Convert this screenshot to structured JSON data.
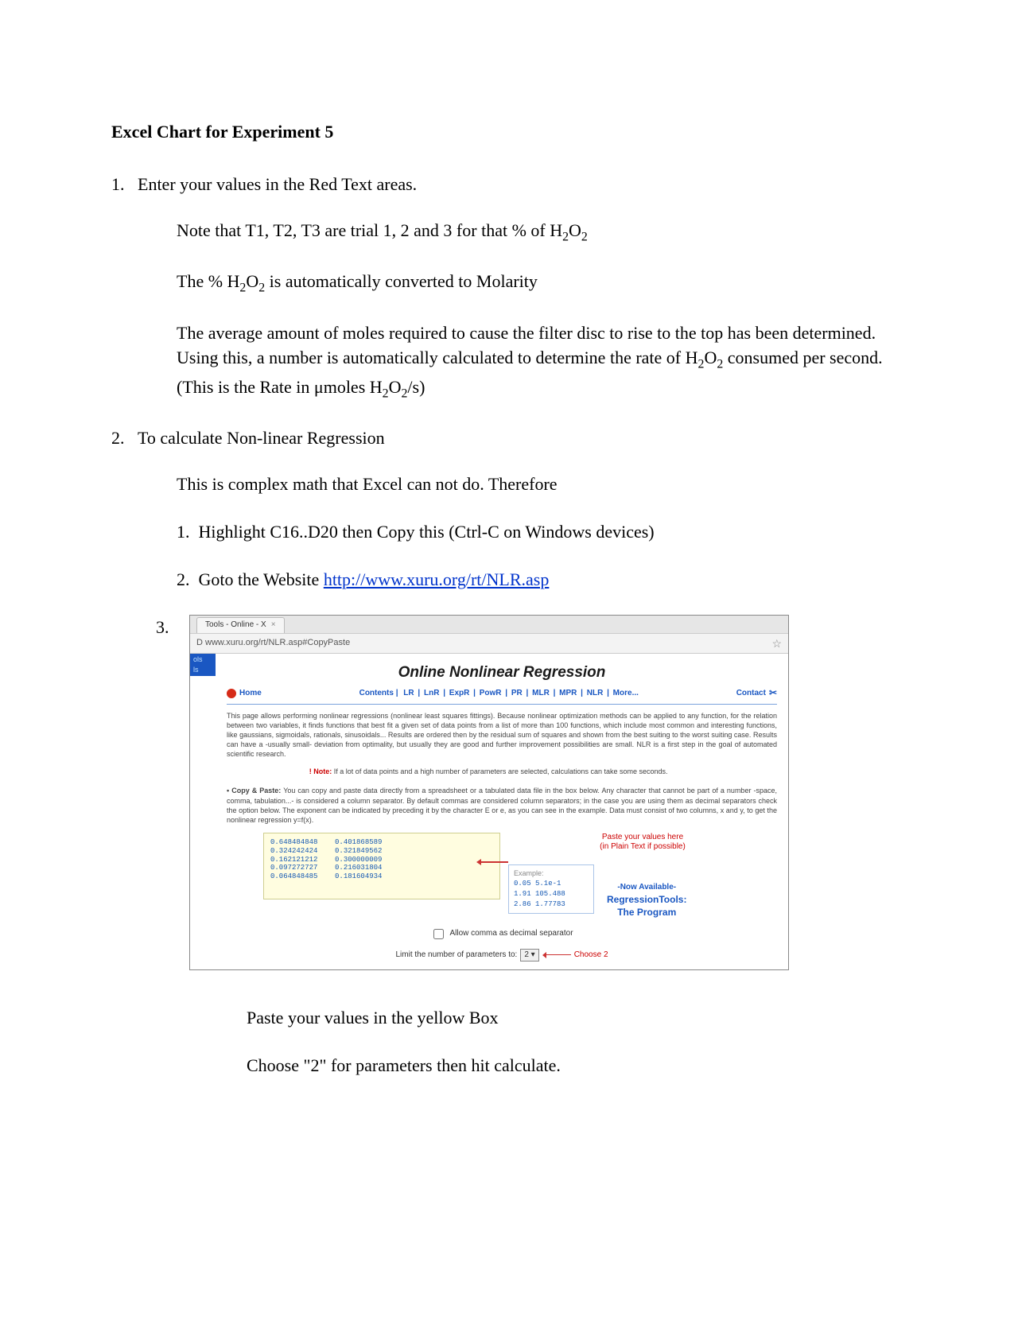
{
  "title": "Excel Chart for Experiment 5",
  "step1": {
    "num": "1.",
    "text": "Enter your values in the Red Text areas.",
    "note_prefix": "Note that T1, T2, T3 are trial 1, 2 and 3 for that % of H",
    "pct_line_prefix": "The % H",
    "pct_line_suffix": " is automatically converted to Molarity",
    "avg_part1": "The average amount of moles required to cause the filter disc to rise to the top has been determined.  Using this, a number is automatically calculated to determine the rate of H",
    "avg_part2": " consumed per second.  (This is the Rate in μmoles H",
    "avg_part3": "/s)"
  },
  "step2": {
    "num": "2.",
    "text": "To calculate Non-linear Regression",
    "intro": "This is complex math that Excel can not do.  Therefore",
    "sub1_num": "1.",
    "sub1_text": "Highlight    C16..D20   then Copy this (Ctrl-C on Windows devices)",
    "sub2_num": "2.",
    "sub2_prefix": "Goto the Website    ",
    "sub2_link": "http://www.xuru.org/rt/NLR.asp",
    "sub3_num": "3."
  },
  "browser": {
    "tab_title": "Tools - Online - X",
    "address": "D www.xuru.org/rt/NLR.asp#CopyPaste",
    "sidebar_top": "ols",
    "sidebar_bot": "ls",
    "page_title": "Online Nonlinear Regression",
    "home": "Home",
    "contents_label": "Contents |",
    "nav_items": [
      "LR",
      "LnR",
      "ExpR",
      "PowR",
      "PR",
      "MLR",
      "MPR",
      "NLR",
      "More..."
    ],
    "contact": "Contact",
    "desc1": "This page allows performing nonlinear regressions (nonlinear least squares fittings). Because nonlinear optimization methods can be applied to any function, for the relation between two variables, it finds functions that best fit a given set of data points from a list of more than 100 functions, which include most common and interesting functions, like gaussians, sigmoidals, rationals, sinusoidals... Results are ordered then by the residual sum of squares and shown from the best suiting to the worst suiting case. Results can have a -usually small- deviation from optimality, but usually they are good and further improvement possibilities are small. NLR is a first step in the goal of automated scientific research.",
    "note_lead": "! Note:",
    "note_text": " If a lot of data points and a high number of parameters are selected, calculations can take some seconds.",
    "desc2_lead": "• Copy & Paste:",
    "desc2_text": " You can copy and paste data directly from a spreadsheet or a tabulated data file in the box below. Any character that cannot be part of a number -space, comma, tabulation...- is considered a column separator. By default commas are considered column separators; in the case you are using them as decimal separators check the option below. The exponent can be indicated by preceding it by the character E or e, as you can see in the example. Data must consist of two columns, x and y, to get the nonlinear regression y=f(x).",
    "data_rows": [
      [
        "0.648484848",
        "0.401868589"
      ],
      [
        "0.324242424",
        "0.321849562"
      ],
      [
        "0.162121212",
        "0.300000009"
      ],
      [
        "0.097272727",
        "0.216031804"
      ],
      [
        "0.064848485",
        "0.181604934"
      ]
    ],
    "paste_hint_l1": "Paste your values here",
    "paste_hint_l2": "(in Plain Text if possible)",
    "example_label": "Example:",
    "example_rows": [
      "0.05 5.1e-1",
      "1.91 105.488",
      "2.86 1.77783"
    ],
    "now_available": "-Now Available-",
    "rt_line1": "RegressionTools:",
    "rt_line2": "The Program",
    "allow_comma": "Allow comma as decimal separator",
    "limit_label": "Limit the number of parameters to:",
    "limit_value": "2 ▾",
    "choose2": "Choose 2"
  },
  "after": {
    "line1": "Paste your values in the yellow Box",
    "line2": "Choose \"2\" for parameters then hit calculate."
  }
}
